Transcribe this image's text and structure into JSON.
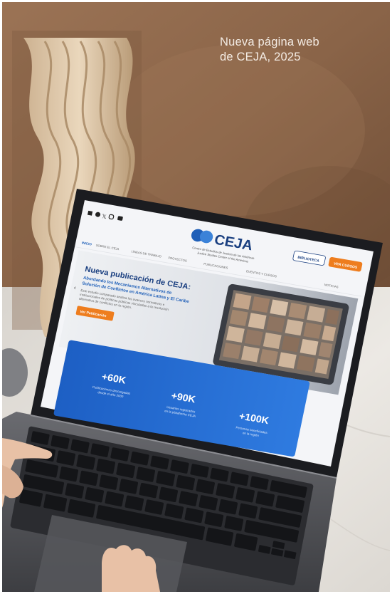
{
  "caption": {
    "line1": "Nueva página web",
    "line2": "de CEJA, 2025"
  },
  "laptop_screen": {
    "logo_text": "CEJA",
    "logo_subtitle_1": "Centro de Estudios de Justicia de las Américas",
    "logo_subtitle_2": "Justice Studies Center of the Americas",
    "nav": {
      "home": "INICIO",
      "items": [
        "SOBRE EL CEJA",
        "LÍNEAS DE TRABAJO",
        "PROYECTOS",
        "PUBLICACIONES",
        "EVENTOS Y CURSOS",
        "NOTICIAS"
      ]
    },
    "button_library": "BIBLIOTECA",
    "button_courses": "VER CURSOS",
    "hero": {
      "title": "Nueva publicación de CEJA:",
      "subtitle_1": "Abordando los Mecanismos Alternativos de",
      "subtitle_2": "Solución de Conflictos en América Latina y El Caribe",
      "body_1": "Este estudio comparado analiza los avances normativos e",
      "body_2": "institucionales de políticas públicas vinculadas a la resolución",
      "body_3": "alternativa de conflictos en la región.",
      "cta": "Ver Publicación"
    },
    "stats": [
      {
        "value": "+60K",
        "label_1": "Publicaciones descargadas",
        "label_2": "desde el año 2000"
      },
      {
        "value": "+90K",
        "label_1": "Usuarios registrados",
        "label_2": "en la plataforma CEJA"
      },
      {
        "value": "+100K",
        "label_1": "Personas beneficiadas",
        "label_2": "en la región"
      }
    ]
  },
  "colors": {
    "wall": "#8a6448",
    "wall_light": "#a27b5d",
    "marble": "#e9e6e2",
    "laptop_body": "#5a5b60",
    "laptop_bezel": "#141518",
    "screen_bg": "#f4f5f8",
    "ceja_blue": "#1f5fb8",
    "stats_blue": "#2a71d6",
    "accent_orange": "#ee7d1e",
    "caption_text": "#f4ece4"
  }
}
